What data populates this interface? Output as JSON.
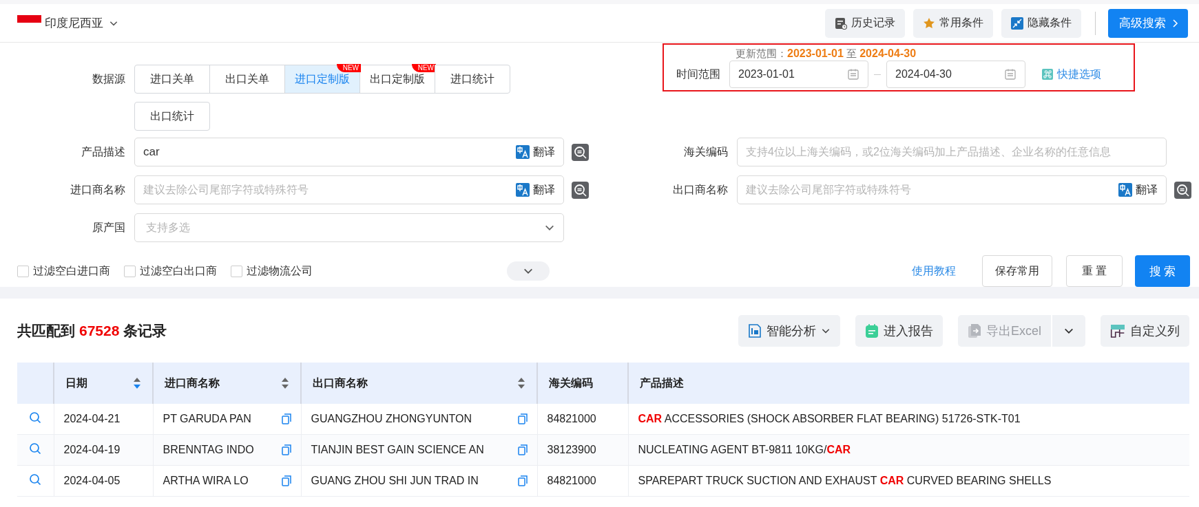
{
  "top_bar": {
    "country": "印度尼西亚",
    "buttons": [
      {
        "label": "历史记录",
        "kind": "history"
      },
      {
        "label": "常用条件",
        "kind": "star"
      },
      {
        "label": "隐藏条件",
        "kind": "collapse"
      }
    ],
    "advanced_search": "高级搜索"
  },
  "form": {
    "data_source": {
      "label": "数据源",
      "tabs": [
        {
          "label": "进口关单",
          "selected": false
        },
        {
          "label": "出口关单",
          "selected": false
        },
        {
          "label": "进口定制版",
          "selected": true,
          "badge": "NEW"
        },
        {
          "label": "出口定制版",
          "selected": false,
          "badge": "NEW"
        },
        {
          "label": "进口统计",
          "selected": false
        },
        {
          "label": "出口统计",
          "selected": false
        }
      ]
    },
    "update_range": {
      "label": "更新范围：",
      "from": "2023-01-01",
      "joiner": "至",
      "to": "2024-04-30"
    },
    "time_range": {
      "label": "时间范围",
      "from": "2023-01-01",
      "to": "2024-04-30",
      "quick": "快捷选项"
    },
    "left_fields": [
      {
        "label": "产品描述",
        "kind": "text",
        "value": "car",
        "translate": "翻译",
        "lookup": true
      },
      {
        "label": "进口商名称",
        "kind": "text",
        "placeholder": "建议去除公司尾部字符或特殊符号",
        "translate": "翻译",
        "lookup": true
      },
      {
        "label": "原产国",
        "kind": "select",
        "placeholder": "支持多选",
        "lookup": false
      }
    ],
    "right_fields": [
      {
        "label": "海关编码",
        "kind": "text",
        "placeholder": "支持4位以上海关编码，或2位海关编码加上产品描述、企业名称的任意信息",
        "lookup": false
      },
      {
        "label": "出口商名称",
        "kind": "text",
        "placeholder": "建议去除公司尾部字符或特殊符号",
        "translate": "翻译",
        "lookup": true
      }
    ],
    "expanded": false,
    "filters": [
      {
        "label": "过滤空白进口商",
        "checked": false
      },
      {
        "label": "过滤空白出口商",
        "checked": false
      },
      {
        "label": "过滤物流公司",
        "checked": false
      }
    ],
    "actions": {
      "tutorial": "使用教程",
      "save": "保存常用",
      "reset": "重 置",
      "search": "搜 索"
    }
  },
  "results": {
    "prefix": "共匹配到",
    "count": "67528",
    "suffix": "条记录",
    "tools": [
      {
        "label": "智能分析",
        "kind": "bi",
        "has_menu": true,
        "split_menu": false,
        "disabled": false
      },
      {
        "label": "进入报告",
        "kind": "report",
        "has_menu": false,
        "split_menu": false,
        "disabled": false
      },
      {
        "label": "导出Excel",
        "kind": "export",
        "has_menu": false,
        "split_menu": true,
        "disabled": true
      },
      {
        "label": "自定义列",
        "kind": "columns",
        "has_menu": false,
        "split_menu": false,
        "disabled": false
      }
    ],
    "table": {
      "columns": [
        {
          "label": "日期",
          "sortable": true,
          "sorted_desc": true
        },
        {
          "label": "进口商名称",
          "sortable": true,
          "sorted_desc": false
        },
        {
          "label": "出口商名称",
          "sortable": true,
          "sorted_desc": false
        },
        {
          "label": "海关编码",
          "sortable": false
        },
        {
          "label": "产品描述",
          "sortable": false
        }
      ],
      "rows": [
        {
          "date": "2024-04-21",
          "importer": "PT GARUDA PAN",
          "exporter": "GUANGZHOU ZHONGYUNTON",
          "hs_code": "84821000",
          "description": "**CAR** ACCESSORIES (SHOCK ABSORBER FLAT BEARING) 51726-STK-T01"
        },
        {
          "date": "2024-04-19",
          "importer": "BRENNTAG INDO",
          "exporter": "TIANJIN BEST GAIN SCIENCE AN",
          "hs_code": "38123900",
          "description": "NUCLEATING AGENT BT-9811 10KG/**CAR**"
        },
        {
          "date": "2024-04-05",
          "importer": "ARTHA WIRA LO",
          "exporter": "GUANG ZHOU SHI JUN TRAD IN",
          "hs_code": "84821000",
          "description": "SPAREPART TRUCK SUCTION AND EXHAUST **CAR** CURVED BEARING SHELLS"
        }
      ]
    }
  }
}
